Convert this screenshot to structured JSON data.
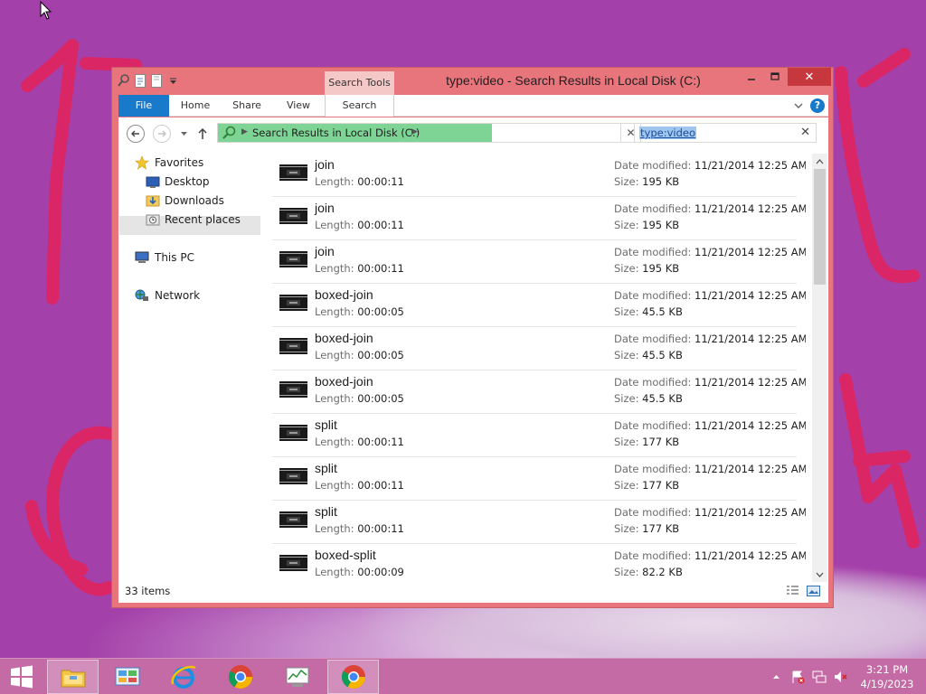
{
  "window": {
    "title": "type:video - Search Results in Local Disk (C:)",
    "context_group_label": "Search Tools",
    "close_glyph": "✕",
    "help_glyph": "?"
  },
  "ribbon": {
    "tabs": [
      {
        "label": "File"
      },
      {
        "label": "Home"
      },
      {
        "label": "Share"
      },
      {
        "label": "View"
      },
      {
        "label": "Search"
      }
    ]
  },
  "address": {
    "path": "Search Results in Local Disk (C:)",
    "progress_fraction": 0.68,
    "clear_glyph": "✕"
  },
  "search": {
    "query": "type:video",
    "clear_glyph": "✕"
  },
  "nav_pane": {
    "items": [
      {
        "label": "Favorites",
        "icon": "star-icon"
      },
      {
        "label": "Desktop",
        "icon": "desktop-icon"
      },
      {
        "label": "Downloads",
        "icon": "downloads-icon"
      },
      {
        "label": "Recent places",
        "icon": "recent-places-icon"
      },
      {
        "label": "This PC",
        "icon": "computer-icon"
      },
      {
        "label": "Network",
        "icon": "network-icon"
      }
    ]
  },
  "labels": {
    "length": "Length:",
    "date_modified": "Date modified:",
    "size": "Size:"
  },
  "files": [
    {
      "name": "join",
      "length": "00:00:11",
      "date": "11/21/2014 12:25 AM",
      "size": "195 KB"
    },
    {
      "name": "join",
      "length": "00:00:11",
      "date": "11/21/2014 12:25 AM",
      "size": "195 KB"
    },
    {
      "name": "join",
      "length": "00:00:11",
      "date": "11/21/2014 12:25 AM",
      "size": "195 KB"
    },
    {
      "name": "boxed-join",
      "length": "00:00:05",
      "date": "11/21/2014 12:25 AM",
      "size": "45.5 KB"
    },
    {
      "name": "boxed-join",
      "length": "00:00:05",
      "date": "11/21/2014 12:25 AM",
      "size": "45.5 KB"
    },
    {
      "name": "boxed-join",
      "length": "00:00:05",
      "date": "11/21/2014 12:25 AM",
      "size": "45.5 KB"
    },
    {
      "name": "split",
      "length": "00:00:11",
      "date": "11/21/2014 12:25 AM",
      "size": "177 KB"
    },
    {
      "name": "split",
      "length": "00:00:11",
      "date": "11/21/2014 12:25 AM",
      "size": "177 KB"
    },
    {
      "name": "split",
      "length": "00:00:11",
      "date": "11/21/2014 12:25 AM",
      "size": "177 KB"
    },
    {
      "name": "boxed-split",
      "length": "00:00:09",
      "date": "11/21/2014 12:25 AM",
      "size": "82.2 KB"
    }
  ],
  "status": {
    "item_count": "33 items"
  },
  "taskbar": {
    "apps": [
      {
        "icon": "file-explorer-icon",
        "active": true
      },
      {
        "icon": "control-panel-icon",
        "active": false
      },
      {
        "icon": "internet-explorer-icon",
        "active": false
      },
      {
        "icon": "chrome-icon",
        "active": false
      },
      {
        "icon": "performance-monitor-icon",
        "active": false
      },
      {
        "icon": "chrome-icon",
        "active": true
      }
    ],
    "tray_icons": [
      "show-hidden-icons-icon",
      "action-center-flag-icon",
      "network-icon",
      "volume-muted-icon"
    ],
    "time": "3:21 PM",
    "date": "4/19/2023"
  },
  "colors": {
    "desktop": "#a340a9",
    "window_frame": "#e8747c",
    "file_tab": "#1979ca",
    "close_button": "#c7383e",
    "address_progress": "#7ed494",
    "search_highlight": "#9fc6ee",
    "taskbar": "#c46aa4"
  }
}
